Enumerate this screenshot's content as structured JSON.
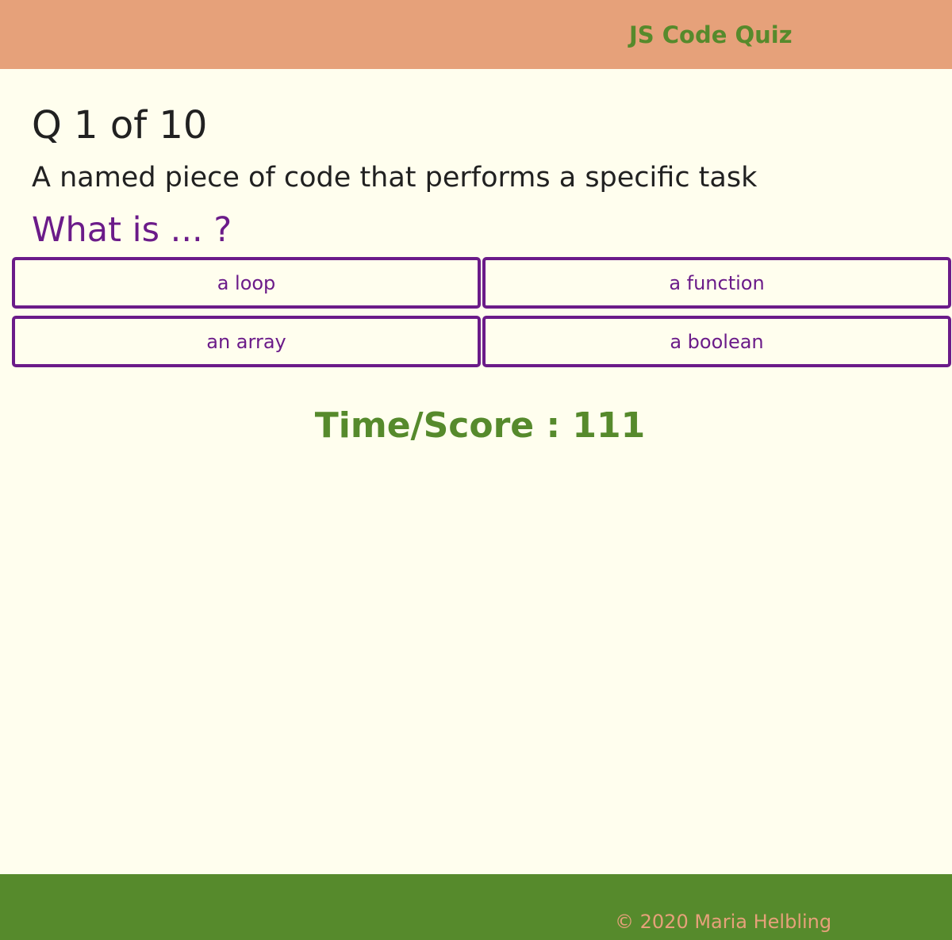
{
  "header": {
    "title": "JS Code Quiz"
  },
  "quiz": {
    "counter": "Q 1 of 10",
    "question": "A named piece of code that performs a specific task",
    "prompt": "What is ... ?",
    "answers": [
      {
        "label": "a loop"
      },
      {
        "label": "a function"
      },
      {
        "label": "an array"
      },
      {
        "label": "a boolean"
      }
    ]
  },
  "score": {
    "text": "Time/Score : 111"
  },
  "footer": {
    "copyright": "© 2020 Maria Helbling"
  },
  "colors": {
    "header_bg": "#e6a17a",
    "accent_green": "#568a2c",
    "accent_purple": "#6b1b89",
    "page_bg": "#fffeee",
    "text": "#212121"
  }
}
